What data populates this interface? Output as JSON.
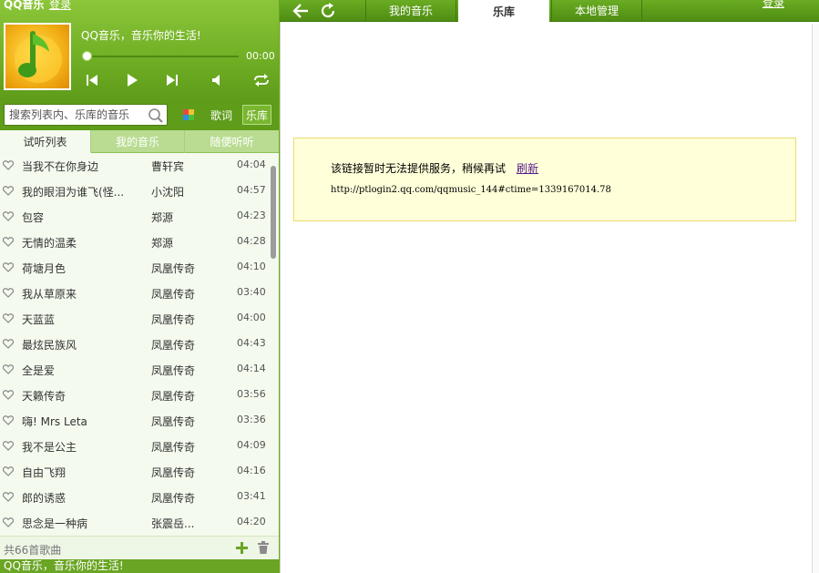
{
  "left": {
    "app_title": "QQ音乐",
    "login_label": "登录",
    "slogan": "QQ音乐，音乐你的生活!",
    "time": "00:00",
    "search_placeholder": "搜索列表内、乐库的音乐",
    "lyrics_label": "歌词",
    "library_label": "乐库",
    "tabs": [
      {
        "label": "试听列表",
        "active": true
      },
      {
        "label": "我的音乐",
        "active": false
      },
      {
        "label": "随便听听",
        "active": false
      }
    ],
    "songs": [
      {
        "title": "当我不在你身边",
        "artist": "曹轩宾",
        "duration": "04:04"
      },
      {
        "title": "我的眼泪为谁飞(怪...",
        "artist": "小沈阳",
        "duration": "04:57"
      },
      {
        "title": "包容",
        "artist": "郑源",
        "duration": "04:23"
      },
      {
        "title": "无情的温柔",
        "artist": "郑源",
        "duration": "04:28"
      },
      {
        "title": "荷塘月色",
        "artist": "凤凰传奇",
        "duration": "04:10"
      },
      {
        "title": "我从草原来",
        "artist": "凤凰传奇",
        "duration": "03:40"
      },
      {
        "title": "天蓝蓝",
        "artist": "凤凰传奇",
        "duration": "04:00"
      },
      {
        "title": "最炫民族风",
        "artist": "凤凰传奇",
        "duration": "04:43"
      },
      {
        "title": "全是爱",
        "artist": "凤凰传奇",
        "duration": "04:14"
      },
      {
        "title": "天籁传奇",
        "artist": "凤凰传奇",
        "duration": "03:56"
      },
      {
        "title": "嗨! Mrs Leta",
        "artist": "凤凰传奇",
        "duration": "03:36"
      },
      {
        "title": "我不是公主",
        "artist": "凤凰传奇",
        "duration": "04:09"
      },
      {
        "title": "自由飞翔",
        "artist": "凤凰传奇",
        "duration": "04:16"
      },
      {
        "title": "郎的诱惑",
        "artist": "凤凰传奇",
        "duration": "03:41"
      },
      {
        "title": "思念是一种病",
        "artist": "张震岳...",
        "duration": "04:20"
      }
    ],
    "song_count": "共66首歌曲",
    "status_text": "QQ音乐，音乐你的生活!"
  },
  "right": {
    "tabs": [
      {
        "label": "我的音乐",
        "active": false
      },
      {
        "label": "乐库",
        "active": true
      },
      {
        "label": "本地管理",
        "active": false
      }
    ],
    "top_right_link": "登录",
    "error_message": "该链接暂时无法提供服务，稍候再试",
    "refresh_label": "刷新",
    "error_url": "http://ptlogin2.qq.com/qqmusic_144#ctime=1339167014.78"
  },
  "colors": {
    "accent_green": "#6aa524",
    "error_bg": "#ffffd9",
    "link_purple": "#551a8b"
  }
}
